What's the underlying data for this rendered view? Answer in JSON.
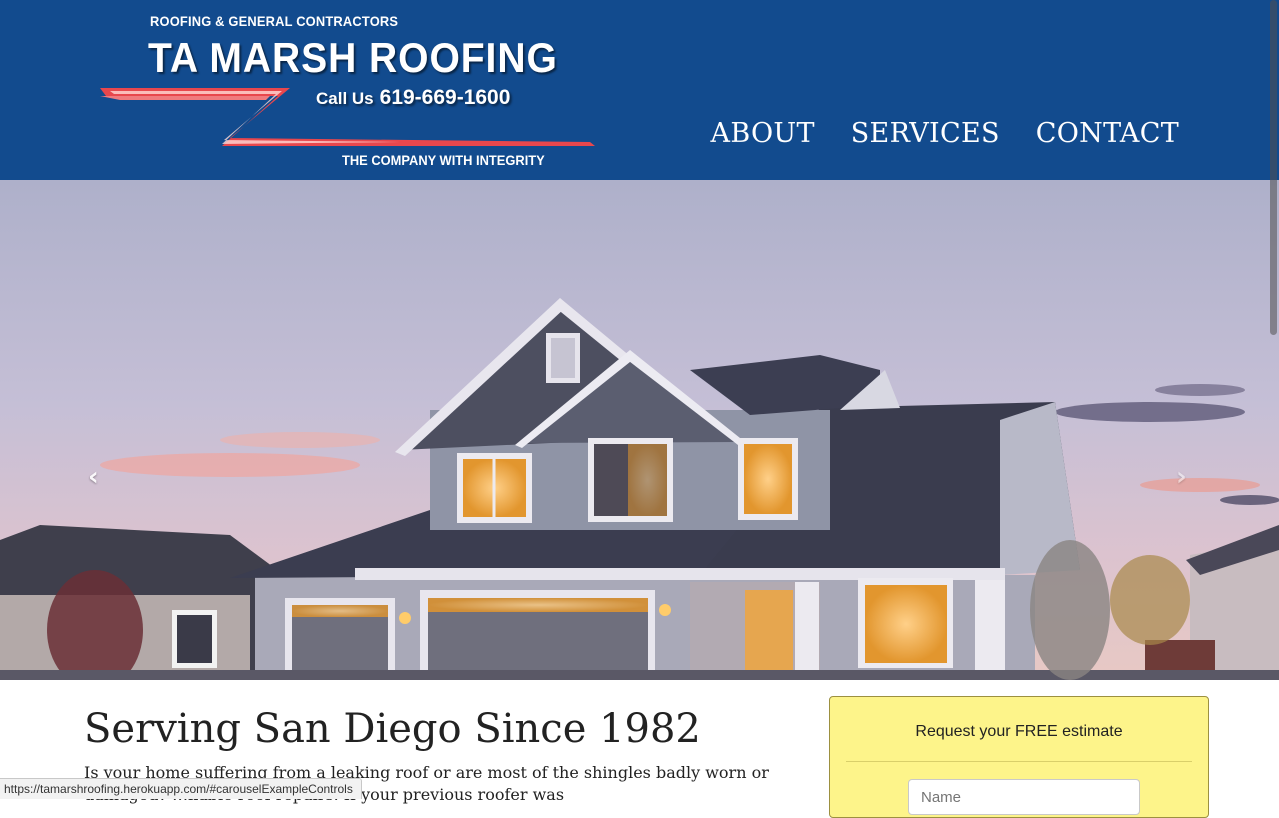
{
  "header": {
    "logo": {
      "tagline_top": "ROOFING & GENERAL CONTRACTORS",
      "brand": "TA MARSH ROOFING",
      "call_label": "Call Us",
      "phone": "619-669-1600",
      "tagline_bottom": "THE COMPANY WITH INTEGRITY"
    },
    "nav": [
      {
        "label": "ABOUT"
      },
      {
        "label": "SERVICES"
      },
      {
        "label": "CONTACT"
      }
    ]
  },
  "carousel": {
    "prev_icon": "chevron-left-icon",
    "next_icon": "chevron-right-icon",
    "prev_glyph": "‹",
    "next_glyph": "›"
  },
  "main": {
    "heading": "Serving San Diego Since 1982",
    "paragraph": "Is your home suffering from a leaking roof or are most of the shingles badly worn or damaged? …liable roof repairs. If your previous roofer was"
  },
  "estimate_form": {
    "title": "Request your FREE estimate",
    "name_placeholder": "Name"
  },
  "statusbar": {
    "url": "https://tamarshroofing.herokuapp.com/#carouselExampleControls"
  },
  "colors": {
    "header_bg": "#124b8e",
    "form_bg": "#fdf48a",
    "swoosh": "#e8474d"
  }
}
